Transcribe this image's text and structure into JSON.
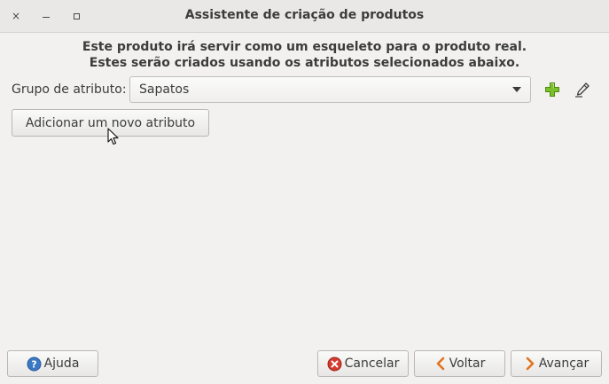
{
  "window": {
    "title": "Assistente de criação de produtos",
    "controls": {
      "close": "×"
    }
  },
  "heading": {
    "line1": "Este produto irá servir como um esqueleto para o produto real.",
    "line2": "Estes serão criados usando os atributos selecionados abaixo."
  },
  "attribute_group": {
    "label": "Grupo de atributo:",
    "selected": "Sapatos",
    "add_icon": "plus-icon",
    "edit_icon": "pencil-icon"
  },
  "actions": {
    "add_attribute": "Adicionar um novo atributo"
  },
  "footer": {
    "help": "Ajuda",
    "cancel": "Cancelar",
    "back": "Voltar",
    "next": "Avançar"
  },
  "colors": {
    "background": "#f2f1f0",
    "add_green": "#7bbf2a",
    "help_blue": "#3a78c5",
    "cancel_red": "#d43b2f",
    "nav_orange": "#e2731f"
  }
}
